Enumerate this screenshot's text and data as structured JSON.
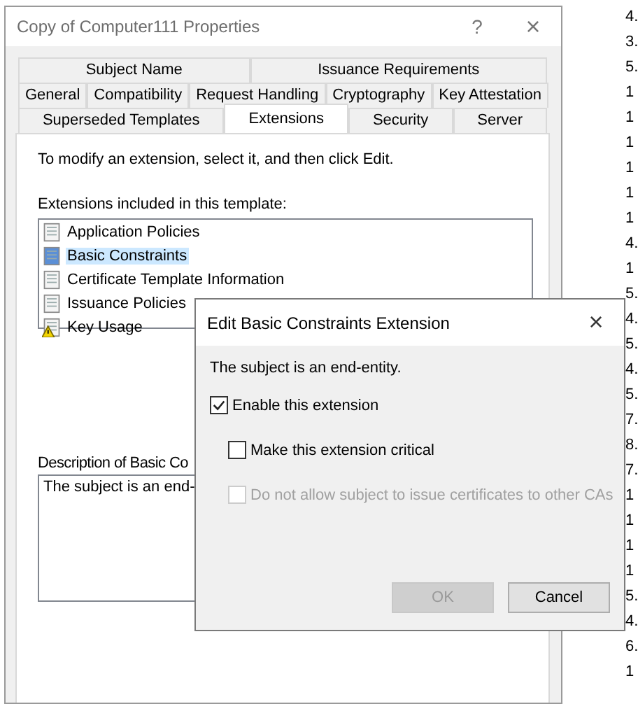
{
  "window": {
    "title": "Copy of Computer111 Properties",
    "help": "?",
    "close": "×"
  },
  "tab_rows": [
    [
      {
        "label": "Subject Name",
        "selected": false
      },
      {
        "label": "Issuance Requirements",
        "selected": false
      }
    ],
    [
      {
        "label": "General",
        "selected": false
      },
      {
        "label": "Compatibility",
        "selected": false
      },
      {
        "label": "Request Handling",
        "selected": false
      },
      {
        "label": "Cryptography",
        "selected": false
      },
      {
        "label": "Key Attestation",
        "selected": false
      }
    ],
    [
      {
        "label": "Superseded Templates",
        "selected": false
      },
      {
        "label": "Extensions",
        "selected": true
      },
      {
        "label": "Security",
        "selected": false
      },
      {
        "label": "Server",
        "selected": false
      }
    ]
  ],
  "instructions": "To modify an extension, select it, and then click Edit.",
  "extensions_label": "Extensions included in this template:",
  "extensions": [
    {
      "name": "Application Policies",
      "selected": false,
      "warning": false
    },
    {
      "name": "Basic Constraints",
      "selected": true,
      "warning": false
    },
    {
      "name": "Certificate Template Information",
      "selected": false,
      "warning": false
    },
    {
      "name": "Issuance Policies",
      "selected": false,
      "warning": false
    },
    {
      "name": "Key Usage",
      "selected": false,
      "warning": true
    }
  ],
  "description_label": "Description of Basic Co",
  "description": "The subject is an end-",
  "dialog": {
    "title": "Edit Basic Constraints Extension",
    "close": "×",
    "message": "The subject is an end-entity.",
    "options": [
      {
        "label": "Enable this extension",
        "checked": true,
        "disabled": false,
        "children": [
          {
            "label": "Make this extension critical",
            "checked": false,
            "disabled": false
          },
          {
            "label": "Do not allow subject to issue certificates to other CAs",
            "checked": false,
            "disabled": true
          }
        ]
      }
    ],
    "buttons": [
      {
        "label": "OK",
        "disabled": true
      },
      {
        "label": "Cancel",
        "disabled": false
      }
    ]
  },
  "background_list": [
    "4.",
    "3.",
    "5.",
    "1",
    "1",
    "1",
    "1",
    "1",
    "1",
    "4.",
    "1",
    "5.",
    "4.",
    "5.",
    "4.",
    "5.",
    "7.",
    "8.",
    "7.",
    "1",
    "1",
    "1",
    "1",
    "5.",
    "4.",
    "6.",
    "1"
  ]
}
